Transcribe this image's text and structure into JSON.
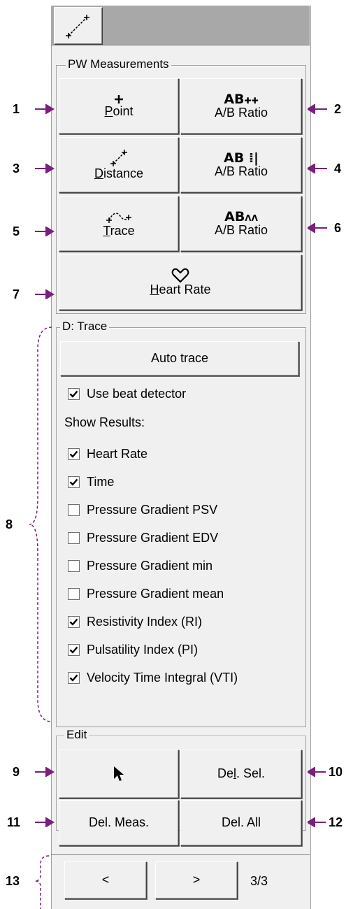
{
  "groups": {
    "pw": "PW Measurements",
    "trace": "D: Trace",
    "edit": "Edit"
  },
  "buttons": {
    "point": {
      "pre": "",
      "u": "P",
      "post": "oint"
    },
    "ab_ratio_1": {
      "ab": "AB",
      "label": "A/B Ratio"
    },
    "distance": {
      "pre": "",
      "u": "D",
      "post": "istance"
    },
    "ab_ratio_2": {
      "ab": "AB",
      "label": "A/B Ratio"
    },
    "trace": {
      "pre": "",
      "u": "T",
      "post": "race"
    },
    "ab_ratio_3": {
      "ab": "AB",
      "label": "A/B Ratio"
    },
    "heart_rate": {
      "pre": "",
      "u": "H",
      "post": "eart Rate"
    },
    "auto_trace": "Auto trace",
    "del_sel": {
      "pre": "De",
      "u": "l",
      "post": ". Sel."
    },
    "del_meas": "Del. Meas.",
    "del_all": "Del. All",
    "prev": "<",
    "next": ">"
  },
  "use_beat_detector": {
    "label": "Use beat detector",
    "checked": true
  },
  "show_results_label": "Show Results:",
  "results": [
    {
      "label": "Heart Rate",
      "checked": true
    },
    {
      "label": "Time",
      "checked": true
    },
    {
      "label": "Pressure Gradient PSV",
      "checked": false
    },
    {
      "label": "Pressure Gradient EDV",
      "checked": false
    },
    {
      "label": "Pressure Gradient min",
      "checked": false
    },
    {
      "label": "Pressure Gradient mean",
      "checked": false
    },
    {
      "label": "Resistivity Index (RI)",
      "checked": true
    },
    {
      "label": "Pulsatility Index (PI)",
      "checked": true
    },
    {
      "label": "Velocity Time Integral (VTI)",
      "checked": true
    }
  ],
  "page_indicator": "3/3",
  "callouts": [
    "1",
    "2",
    "3",
    "4",
    "5",
    "6",
    "7",
    "8",
    "9",
    "10",
    "11",
    "12",
    "13"
  ],
  "colors": {
    "callout_arrow": "#7a1f7a",
    "panel": "#f0f0f0",
    "topbar": "#a8a8a8"
  }
}
